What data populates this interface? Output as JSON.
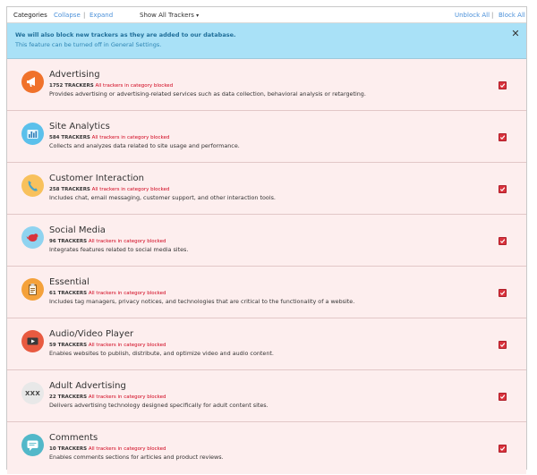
{
  "toolbar": {
    "categories_label": "Categories",
    "collapse_label": "Collapse",
    "separator": "|",
    "expand_label": "Expand",
    "filter_label": "Show All Trackers",
    "filter_caret": "▾",
    "unblock_all_label": "Unblock All",
    "block_all_label": "Block All"
  },
  "banner": {
    "line1": "We will also block new trackers as they are added to our database.",
    "line2": "This feature can be turned off in General Settings.",
    "close_glyph": "✕"
  },
  "categories": [
    {
      "title": "Advertising",
      "count": "1752 TRACKERS",
      "status": "All trackers in category blocked",
      "description": "Provides advertising or advertising-related services such as data collection, behavioral analysis or retargeting.",
      "icon": "megaphone-icon",
      "icon_bg": "#f0722b"
    },
    {
      "title": "Site Analytics",
      "count": "584 TRACKERS",
      "status": "All trackers in category blocked",
      "description": "Collects and analyzes data related to site usage and performance.",
      "icon": "bar-chart-icon",
      "icon_bg": "#5bc0eb"
    },
    {
      "title": "Customer Interaction",
      "count": "258 TRACKERS",
      "status": "All trackers in category blocked",
      "description": "Includes chat, email messaging, customer support, and other interaction tools.",
      "icon": "phone-icon",
      "icon_bg": "#f8c15c"
    },
    {
      "title": "Social Media",
      "count": "96 TRACKERS",
      "status": "All trackers in category blocked",
      "description": "Integrates features related to social media sites.",
      "icon": "bird-icon",
      "icon_bg": "#8fd3f0"
    },
    {
      "title": "Essential",
      "count": "61 TRACKERS",
      "status": "All trackers in category blocked",
      "description": "Includes tag managers, privacy notices, and technologies that are critical to the functionality of a website.",
      "icon": "clipboard-icon",
      "icon_bg": "#f4a13a"
    },
    {
      "title": "Audio/Video Player",
      "count": "59 TRACKERS",
      "status": "All trackers in category blocked",
      "description": "Enables websites to publish, distribute, and optimize video and audio content.",
      "icon": "play-icon",
      "icon_bg": "#e85a40"
    },
    {
      "title": "Adult Advertising",
      "count": "22 TRACKERS",
      "status": "All trackers in category blocked",
      "description": "Delivers advertising technology designed specifically for adult content sites.",
      "icon": "xxx-icon",
      "icon_bg": "#e8e8e8",
      "icon_text": "XXX"
    },
    {
      "title": "Comments",
      "count": "10 TRACKERS",
      "status": "All trackers in category blocked",
      "description": "Enables comments sections for articles and product reviews.",
      "icon": "comment-bubble-icon",
      "icon_bg": "#52b8c9"
    }
  ],
  "colors": {
    "row_bg": "#fdeeee",
    "blocked_text": "#d0021b",
    "link": "#4a90d9",
    "banner_bg": "#a9e1f7",
    "checkbox": "#d9333d"
  }
}
